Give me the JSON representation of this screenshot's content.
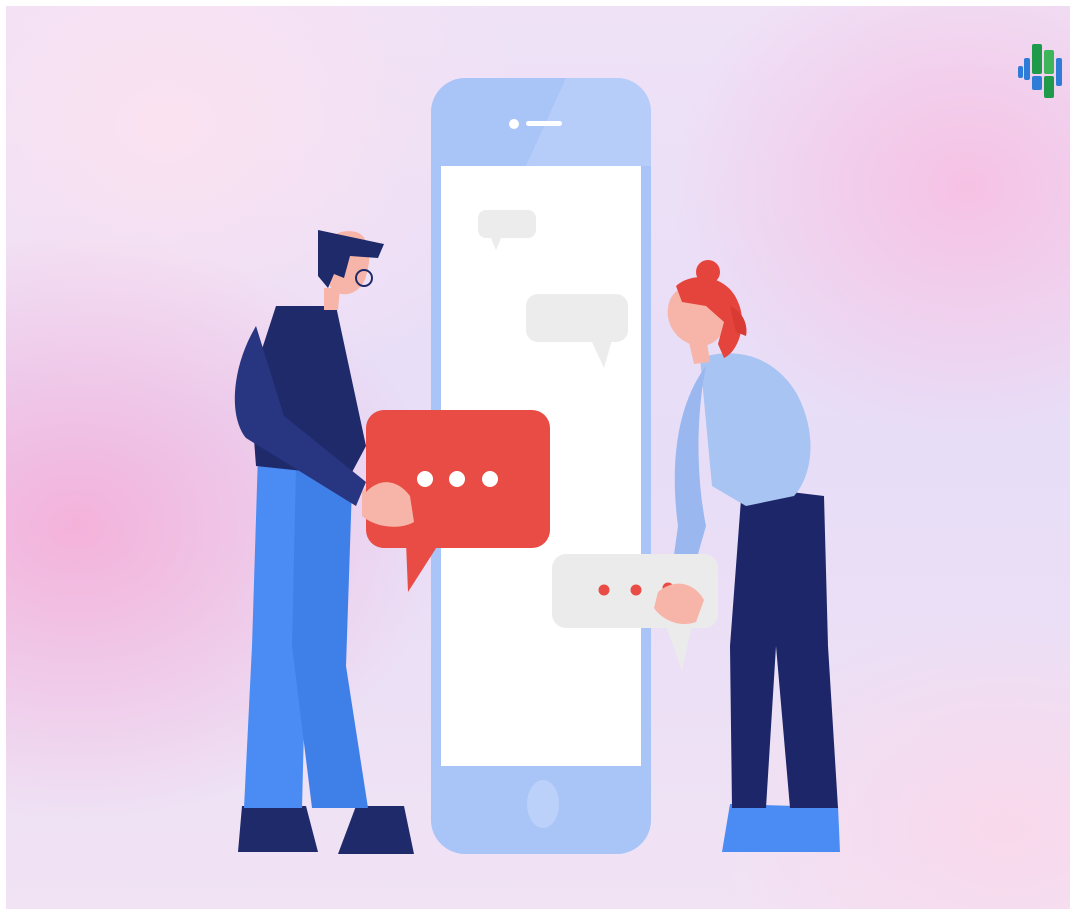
{
  "illustration": {
    "subject": "",
    "colors": {
      "phone_body": "#a9c4f7",
      "phone_screen": "#ffffff",
      "bubble_red": "#e94b45",
      "bubble_grey": "#ebebeb",
      "man_shirt": "#1f2a6b",
      "man_pants": "#4a8cf4",
      "woman_shirt": "#a8c4f3",
      "woman_pants": "#1d2668",
      "woman_hair": "#e5443c",
      "skin": "#f6b5a8",
      "logo_blue": "#2e7bd8",
      "logo_green": "#3fb55a"
    },
    "icons": [
      "chat-bubble-icon",
      "typing-dots-icon",
      "brand-logo-icon",
      "phone-home-button-icon"
    ]
  }
}
